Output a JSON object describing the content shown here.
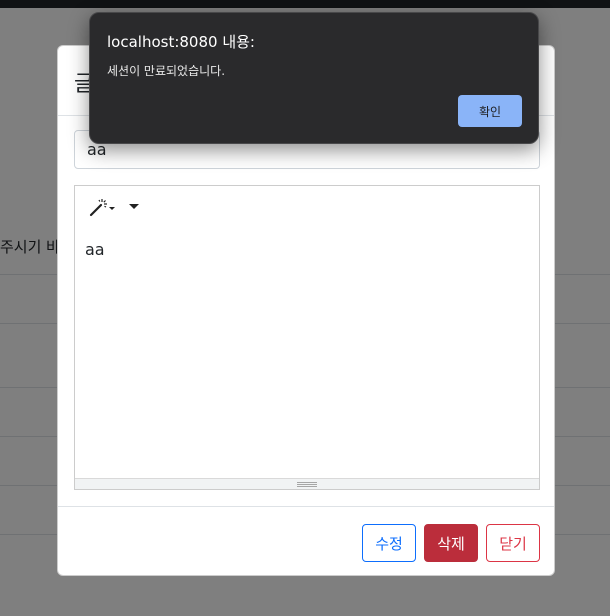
{
  "background": {
    "partial_text": "주시기 바람"
  },
  "modal": {
    "title_partial": "글",
    "title_input_value": "aa",
    "editor_toolbar": {
      "magic_icon": "magic-wand-icon",
      "dropdown_icon": "caret-down-icon"
    },
    "editor_content": "aa",
    "buttons": {
      "edit": "수정",
      "delete": "삭제",
      "close": "닫기"
    }
  },
  "alert": {
    "title": "localhost:8080 내용:",
    "message": "세션이 만료되었습니다.",
    "ok_label": "확인"
  },
  "colors": {
    "primary": "#0d6efd",
    "danger": "#dc3545",
    "danger_dark": "#bb2d3b",
    "alert_bg": "#2a2a2c",
    "alert_button": "#8ab4f8"
  }
}
